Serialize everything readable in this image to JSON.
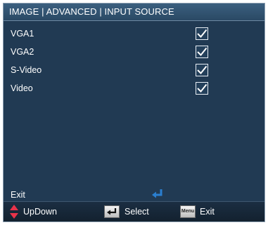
{
  "header": {
    "breadcrumb": "IMAGE | ADVANCED | INPUT SOURCE"
  },
  "items": [
    {
      "label": "VGA1",
      "checked": true
    },
    {
      "label": "VGA2",
      "checked": true
    },
    {
      "label": "S-Video",
      "checked": true
    },
    {
      "label": "Video",
      "checked": true
    }
  ],
  "exit": {
    "label": "Exit"
  },
  "footer": {
    "updown_label": "UpDown",
    "select_label": "Select",
    "menu_key_text": "Menu",
    "exit_label": "Exit"
  },
  "colors": {
    "panel_bg": "#213a53",
    "header_bg": "#2f5272",
    "accent_red": "#e8334a",
    "enter_icon_blue": "#2a7fd0"
  }
}
